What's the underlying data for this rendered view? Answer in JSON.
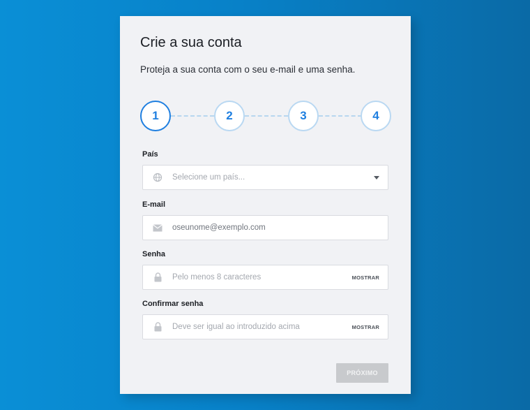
{
  "card": {
    "title": "Crie a sua conta",
    "subtitle": "Proteja a sua conta com o seu e-mail e uma senha."
  },
  "steps": {
    "active": 1,
    "items": [
      "1",
      "2",
      "3",
      "4"
    ]
  },
  "form": {
    "country": {
      "label": "País",
      "placeholder": "Selecione um país...",
      "icon": "globe-icon"
    },
    "email": {
      "label": "E-mail",
      "placeholder": "oseunome@exemplo.com",
      "icon": "mail-icon"
    },
    "password": {
      "label": "Senha",
      "placeholder": "Pelo menos 8 caracteres",
      "icon": "lock-icon",
      "toggle": "MOSTRAR"
    },
    "confirm": {
      "label": "Confirmar senha",
      "placeholder": "Deve ser igual ao introduzido acima",
      "icon": "lock-icon",
      "toggle": "MOSTRAR"
    }
  },
  "buttons": {
    "next": "PRÓXIMO"
  },
  "colors": {
    "accent": "#1f7fe0",
    "background": "#0881c8",
    "card": "#f1f2f5",
    "disabled_button": "#c8cacd"
  }
}
